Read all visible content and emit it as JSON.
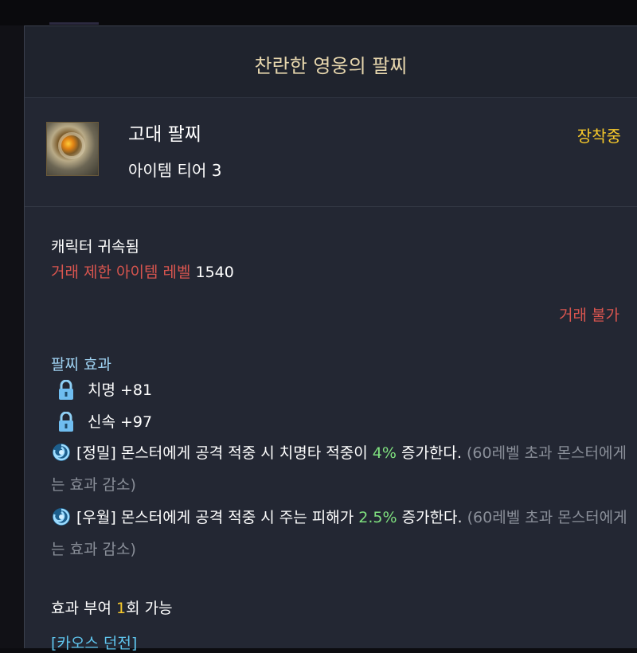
{
  "window": {
    "title": "찬란한 영웅의 팔찌"
  },
  "item": {
    "name": "고대 팔찌",
    "tier_label": "아이템 티어 3",
    "status": "장착중",
    "icon": "bracelet-icon"
  },
  "binding": {
    "bound": "캐릭터 귀속됨",
    "trade_limit_label": "거래 제한 아이템 레벨",
    "trade_limit_value": "1540",
    "trade_status": "거래 불가"
  },
  "effects": {
    "title": "팔찌 효과",
    "stats": [
      {
        "icon": "lock-icon",
        "text": "치명 +81"
      },
      {
        "icon": "lock-icon",
        "text": "신속 +97"
      }
    ],
    "special": [
      {
        "icon": "swirl-icon",
        "prefix": "[정밀] 몬스터에게 공격 적중 시 치명타 적중이",
        "value": "4%",
        "suffix": "증가한다.",
        "note": "(60레벨 초과 몬스터에게는 효과 감소)"
      },
      {
        "icon": "swirl-icon",
        "prefix": "[우월] 몬스터에게 공격 적중 시 주는 피해가",
        "value": "2.5%",
        "suffix": "증가한다.",
        "note": "(60레벨 초과 몬스터에게는 효과 감소)"
      }
    ]
  },
  "grant": {
    "label": "효과 부여",
    "count": "1",
    "suffix": "회 가능"
  },
  "chaos": {
    "label": "[카오스 던전]"
  },
  "colors": {
    "title": "#e6d6ad",
    "equipped": "#f7c92b",
    "warning": "#d9554f",
    "effect_title": "#9fd2f2",
    "value_green": "#7fe07f",
    "note_gray": "#8a8f99",
    "link_blue": "#5fc6ef"
  }
}
